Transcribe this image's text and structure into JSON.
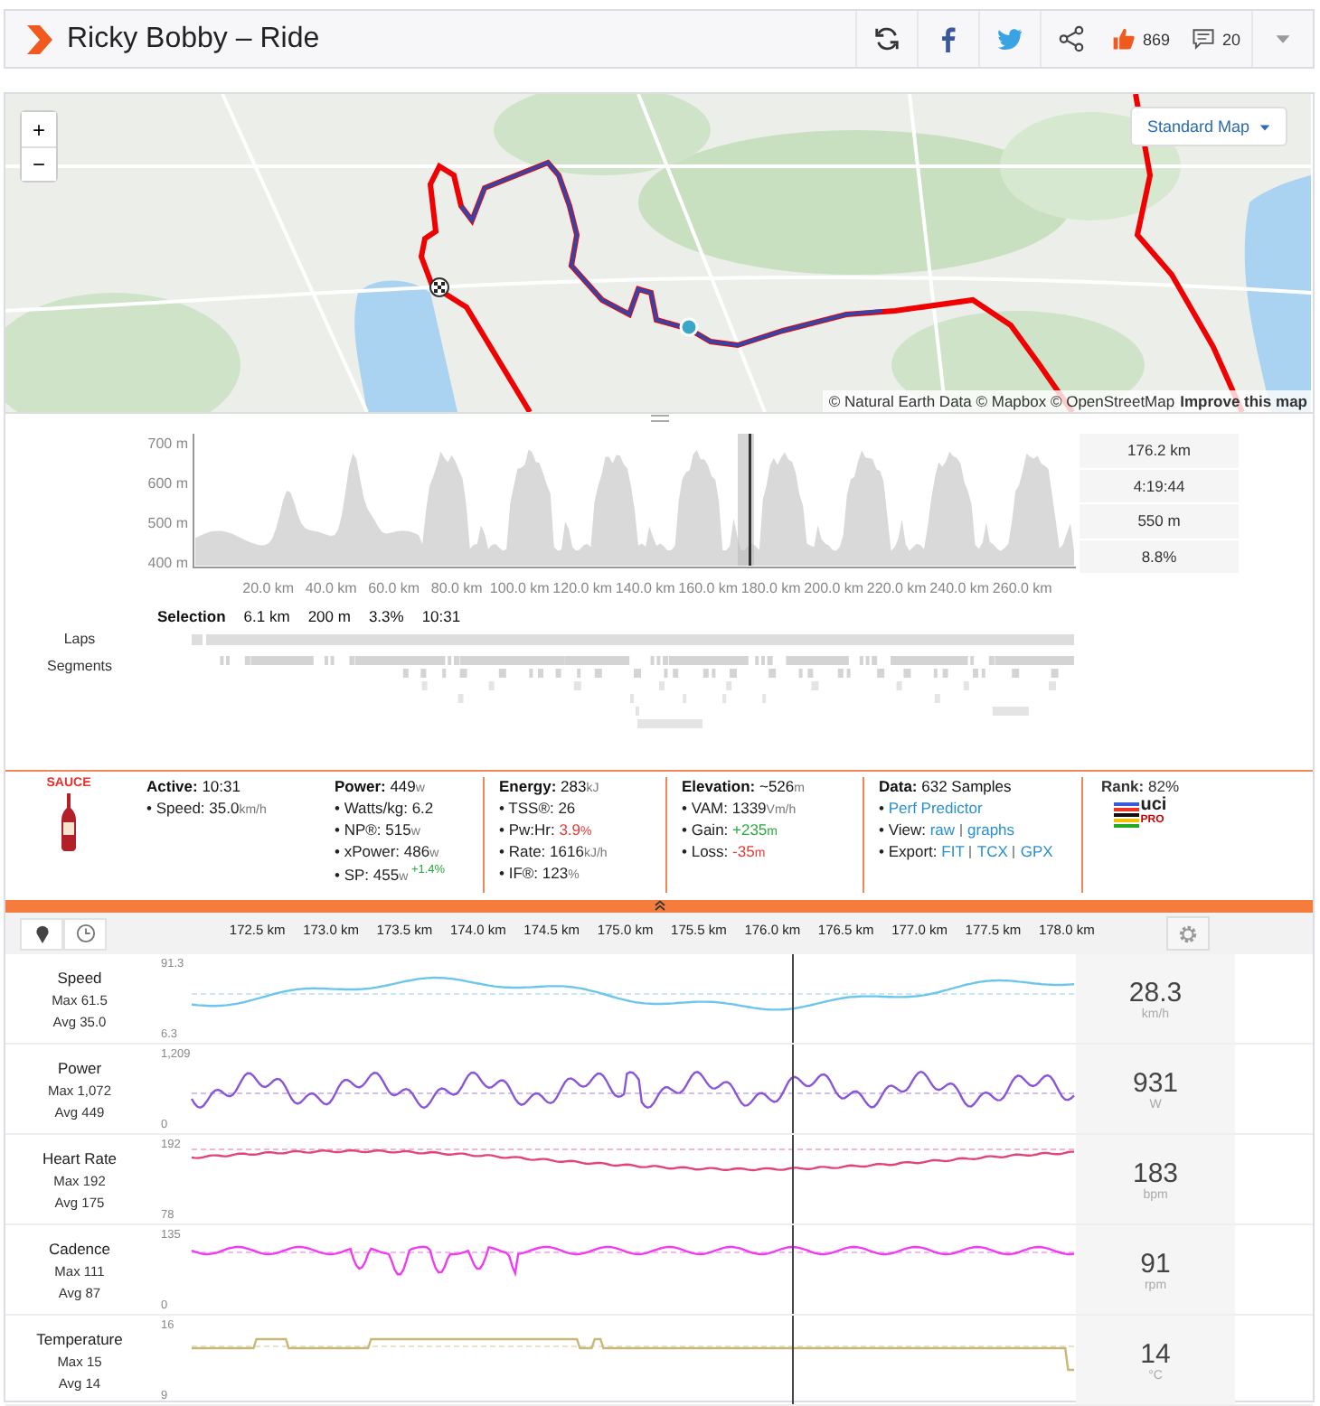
{
  "header": {
    "title": "Ricky Bobby – Ride",
    "likes": "869",
    "comments": "20"
  },
  "map": {
    "zoom_in": "+",
    "zoom_out": "−",
    "style_button": "Standard Map",
    "attribution": "© Natural Earth Data © Mapbox © OpenStreetMap",
    "improve_link": "Improve this map"
  },
  "elevation": {
    "y_labels": [
      "700 m",
      "600 m",
      "500 m",
      "400 m"
    ],
    "x_labels": [
      "20.0 km",
      "40.0 km",
      "60.0 km",
      "80.0 km",
      "100.0 km",
      "120.0 km",
      "140.0 km",
      "160.0 km",
      "180.0 km",
      "200.0 km",
      "220.0 km",
      "240.0 km",
      "260.0 km"
    ],
    "summary": [
      "176.2 km",
      "4:19:44",
      "550 m",
      "8.8%"
    ],
    "selection": {
      "label": "Selection",
      "values": [
        "6.1 km",
        "200 m",
        "3.3%",
        "10:31"
      ]
    },
    "laps_label": "Laps",
    "segments_label": "Segments"
  },
  "stats": {
    "logo_text": "SAUCE",
    "columns": [
      {
        "heading": "Active:",
        "value": "10:31",
        "items": [
          {
            "label": "• Speed:",
            "value": "35.0",
            "unit": "km/h"
          }
        ]
      },
      {
        "heading": "Power:",
        "value": "449",
        "unit": "w",
        "items": [
          {
            "label": "• Watts/kg:",
            "value": "6.2"
          },
          {
            "label": "• NP®:",
            "value": "515",
            "unit": "w"
          },
          {
            "label": "• xPower:",
            "value": "486",
            "unit": "w"
          },
          {
            "label": "• SP:",
            "value": "455",
            "unit": "w",
            "delta": "+1.4%"
          }
        ]
      },
      {
        "heading": "Energy:",
        "value": "283",
        "unit": "kJ",
        "items": [
          {
            "label": "• TSS®:",
            "value": "26"
          },
          {
            "label": "• Pw:Hr:",
            "value": "3.9",
            "unit": "%",
            "color": "#e53935"
          },
          {
            "label": "• Rate:",
            "value": "1616",
            "unit": "kJ/h"
          },
          {
            "label": "• IF®:",
            "value": "123",
            "unit": "%"
          }
        ]
      },
      {
        "heading": "Elevation:",
        "value": "~526",
        "unit": "m",
        "items": [
          {
            "label": "• VAM:",
            "value": "1339",
            "unit": "Vm/h"
          },
          {
            "label": "• Gain:",
            "value": "+235",
            "unit": "m",
            "color": "#2aa83b"
          },
          {
            "label": "• Loss:",
            "value": "-35",
            "unit": "m",
            "color": "#e53935"
          }
        ]
      },
      {
        "heading": "Data:",
        "value": "632 Samples",
        "items": [
          {
            "label": "•",
            "links": [
              "Perf Predictor"
            ]
          },
          {
            "label": "• View:",
            "links": [
              "raw",
              "graphs"
            ]
          },
          {
            "label": "• Export:",
            "links": [
              "FIT",
              "TCX",
              "GPX"
            ]
          }
        ]
      }
    ],
    "rank": {
      "heading": "Rank:",
      "value": "82%",
      "badge": [
        "uci",
        "PRO"
      ]
    }
  },
  "timeline": {
    "ticks": [
      "172.5 km",
      "173.0 km",
      "173.5 km",
      "174.0 km",
      "174.5 km",
      "175.0 km",
      "175.5 km",
      "176.0 km",
      "176.5 km",
      "177.0 km",
      "177.5 km",
      "178.0 km"
    ]
  },
  "streams": [
    {
      "name": "Speed",
      "max": "Max 61.5",
      "avg": "Avg 35.0",
      "ymax": "91.3",
      "ymin": "6.3",
      "current": "28.3",
      "unit": "km/h",
      "color": "#6cc6ec"
    },
    {
      "name": "Power",
      "max": "Max 1,072",
      "avg": "Avg 449",
      "ymax": "1,209",
      "ymin": "0",
      "current": "931",
      "unit": "W",
      "color": "#8a55d8"
    },
    {
      "name": "Heart Rate",
      "max": "Max 192",
      "avg": "Avg 175",
      "ymax": "192",
      "ymin": "78",
      "current": "183",
      "unit": "bpm",
      "color": "#e0447a"
    },
    {
      "name": "Cadence",
      "max": "Max 111",
      "avg": "Avg 87",
      "ymax": "135",
      "ymin": "0",
      "current": "91",
      "unit": "rpm",
      "color": "#f03cf0"
    },
    {
      "name": "Temperature",
      "max": "Max 15",
      "avg": "Avg 14",
      "ymax": "16",
      "ymin": "9",
      "current": "14",
      "unit": "°C",
      "color": "#c8b878"
    }
  ]
}
